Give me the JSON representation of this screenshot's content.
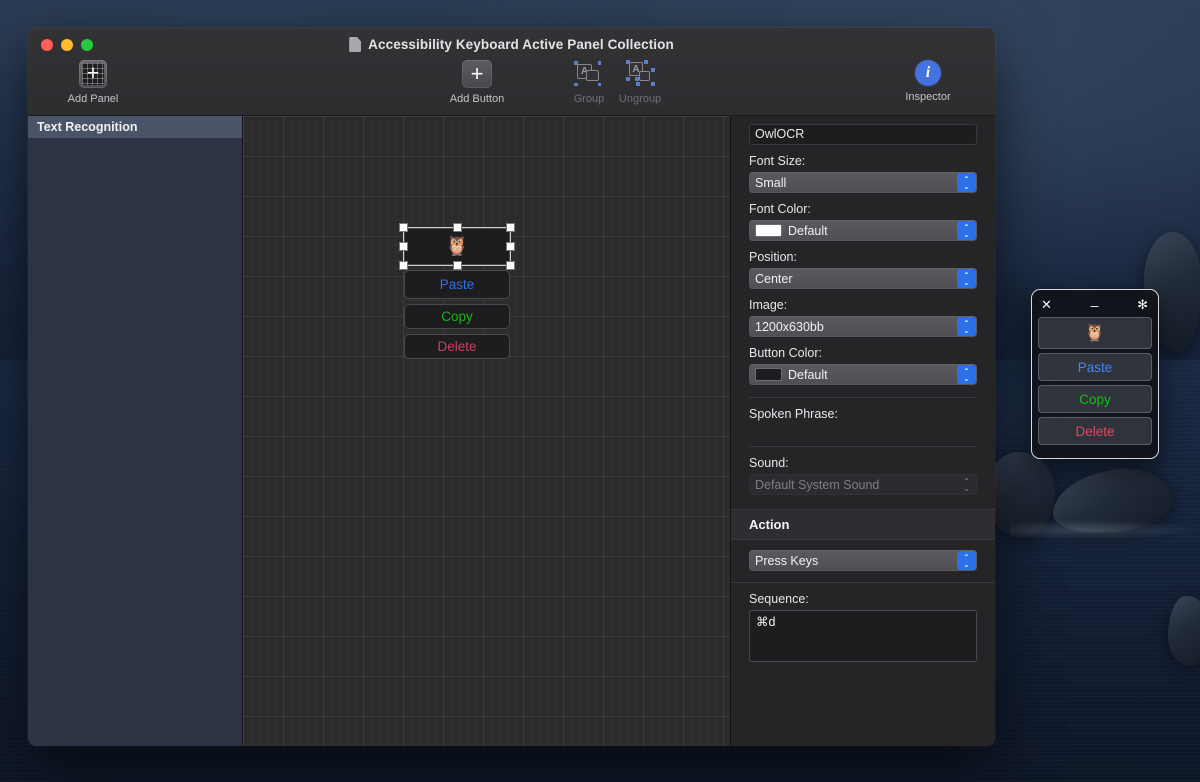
{
  "window": {
    "title": "Accessibility Keyboard Active Panel Collection",
    "doc_icon": "document-icon",
    "traffic": {
      "close": "close",
      "minimize": "minimize",
      "zoom": "zoom"
    }
  },
  "toolbar": {
    "add_panel_label": "Add Panel",
    "add_panel_icon": "add-panel-grid-plus-icon",
    "add_button_label": "Add Button",
    "add_button_icon": "plus-icon",
    "group_label": "Group",
    "group_icon": "group-boxes-icon",
    "ungroup_label": "Ungroup",
    "ungroup_icon": "ungroup-boxes-icon",
    "inspector_label": "Inspector",
    "inspector_icon": "info-circle-icon"
  },
  "sidebar": {
    "items": [
      {
        "label": "Text Recognition",
        "selected": true
      }
    ]
  },
  "canvas": {
    "buttons": [
      {
        "name": "image-button",
        "label": "🦉",
        "kind": "image",
        "selected": true
      },
      {
        "name": "paste-button",
        "label": "Paste",
        "color": "#2f6fe4"
      },
      {
        "name": "copy-button",
        "label": "Copy",
        "color": "#12b512"
      },
      {
        "name": "delete-button",
        "label": "Delete",
        "color": "#d0405c"
      }
    ]
  },
  "inspector": {
    "name_value": "OwlOCR",
    "font_size_label": "Font Size:",
    "font_size_value": "Small",
    "font_color_label": "Font Color:",
    "font_color_value": "Default",
    "font_color_swatch": "#ffffff",
    "position_label": "Position:",
    "position_value": "Center",
    "image_label": "Image:",
    "image_value": "1200x630bb",
    "button_color_label": "Button Color:",
    "button_color_value": "Default",
    "button_color_swatch": "#1d1d1f",
    "spoken_phrase_label": "Spoken Phrase:",
    "spoken_phrase_value": "",
    "sound_label": "Sound:",
    "sound_value": "Default System Sound",
    "action_header": "Action",
    "action_type_value": "Press Keys",
    "sequence_label": "Sequence:",
    "sequence_value": "⌘d",
    "stepper_up": "⌃",
    "stepper_down": "⌄"
  },
  "float_panel": {
    "close_icon": "close-icon",
    "minimize_icon": "minimize-icon",
    "settings_icon": "gear-icon",
    "close_glyph": "✕",
    "minimize_glyph": "–",
    "settings_glyph": "✻",
    "buttons": [
      {
        "name": "image-button",
        "label": "🦉",
        "color": "#f0f0f3"
      },
      {
        "name": "paste-button",
        "label": "Paste",
        "color": "#4a83ec"
      },
      {
        "name": "copy-button",
        "label": "Copy",
        "color": "#15bd15"
      },
      {
        "name": "delete-button",
        "label": "Delete",
        "color": "#dd4763"
      }
    ]
  }
}
